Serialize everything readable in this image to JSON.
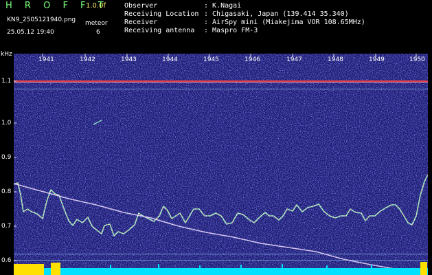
{
  "app": {
    "title": "H R O F F T",
    "version": "1.0.0f"
  },
  "file": {
    "name": "KN9_2505121940.png",
    "timestamp": "25.05.12 19:40"
  },
  "meteor": {
    "label": "meteor",
    "count": "6"
  },
  "info": [
    {
      "key": "Observer",
      "value": ": K.Nagai"
    },
    {
      "key": "Receiving Location",
      "value": ": Chigasaki, Japan (139.414 35.340)"
    },
    {
      "key": "Receiver",
      "value": ": AirSpy mini (Miakejima VOR 108.65MHz)"
    },
    {
      "key": "Receiving antenna",
      "value": ": Maspro FM-3"
    }
  ],
  "axis": {
    "unit": "kHz",
    "y_ticks": [
      "1.1",
      "1.0",
      "0.9",
      "0.8",
      "0.7",
      "0.6"
    ],
    "x_ticks": [
      "1941",
      "1942",
      "1943",
      "1944",
      "1945",
      "1946",
      "1947",
      "1948",
      "1949",
      "1950"
    ]
  },
  "colors": {
    "background": "#1a1a6e",
    "title": "#7CFF7C",
    "version": "#FFF06A",
    "signal": "#ff4040",
    "trace": "#9fffd0",
    "meter": "#FFE000",
    "noise_floor": "#00E0FF"
  }
}
